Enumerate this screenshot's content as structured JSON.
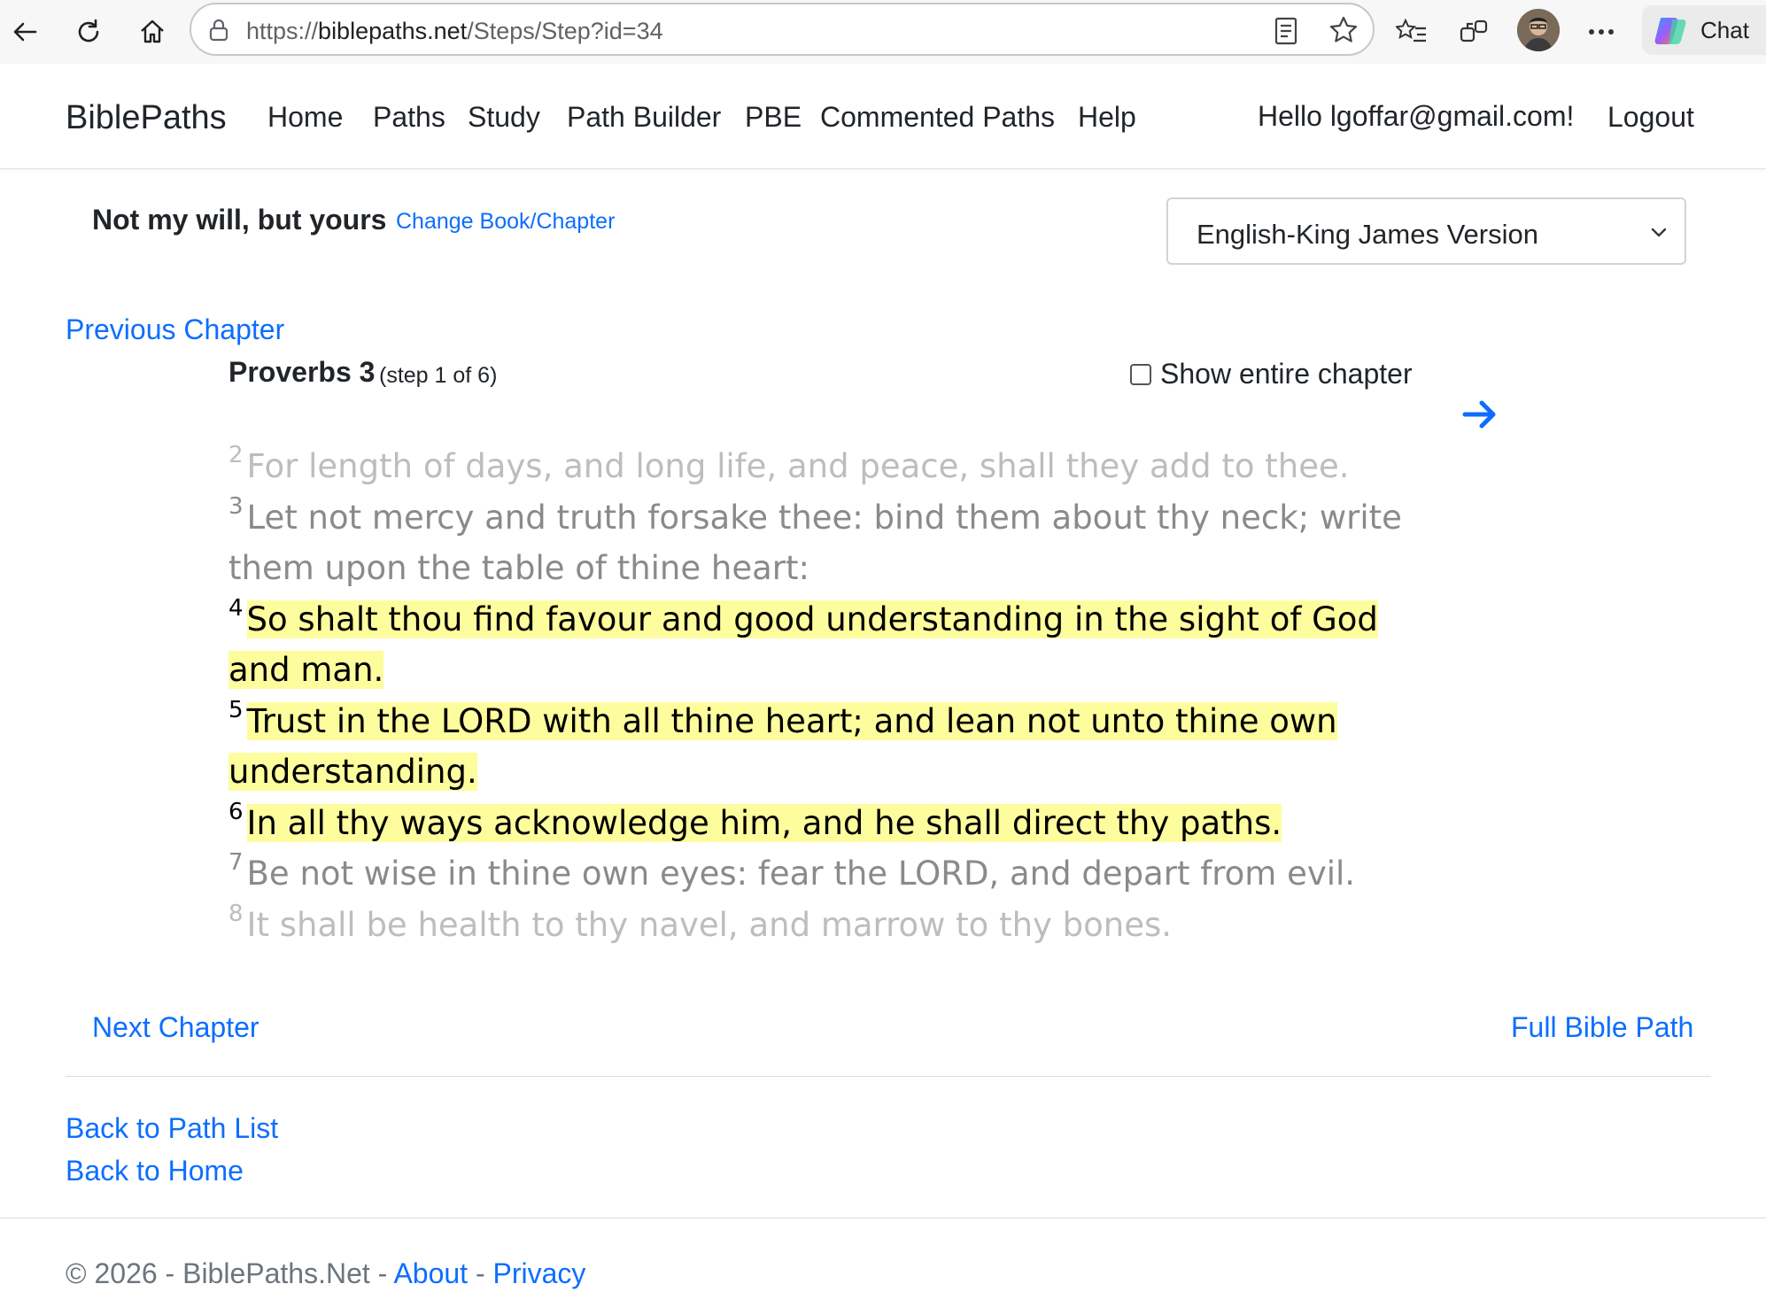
{
  "browser": {
    "url_prefix": "https://",
    "url_host": "biblepaths.net",
    "url_path": "/Steps/Step?id=34",
    "chat_label": "Chat",
    "icons": [
      "back-arrow-icon",
      "refresh-icon",
      "home-icon",
      "site-info-icon",
      "reader-view-icon",
      "favorite-star-icon",
      "favorites-list-icon",
      "extensions-icon",
      "more-icon",
      "copilot-icon"
    ]
  },
  "nav": {
    "brand": "BiblePaths",
    "items": [
      "Home",
      "Paths",
      "Study",
      "Path Builder",
      "PBE",
      "Commented Paths",
      "Help"
    ],
    "greeting": "Hello lgoffar@gmail.com!",
    "logout": "Logout"
  },
  "step": {
    "title": "Not my will, but yours",
    "change_link": "Change Book/Chapter",
    "version": "English-King James Version",
    "previous_chapter": "Previous Chapter",
    "chapter_heading": "Proverbs 3",
    "step_count": "(step 1 of 6)",
    "show_entire_label": "Show entire chapter",
    "show_entire_checked": false,
    "next_chapter": "Next Chapter",
    "full_path": "Full Bible Path"
  },
  "verses": [
    {
      "num": "2",
      "text": "For length of days, and long life, and peace, shall they add to thee.",
      "style": "faint"
    },
    {
      "num": "3",
      "text": "Let not mercy and truth forsake thee: bind them about thy neck; write them upon the table of thine heart:",
      "style": "dim"
    },
    {
      "num": "4",
      "text": "So shalt thou find favour and good understanding in the sight of God and man.",
      "style": "highlight"
    },
    {
      "num": "5",
      "text": "Trust in the LORD with all thine heart; and lean not unto thine own understanding.",
      "style": "highlight"
    },
    {
      "num": "6",
      "text": "In all thy ways acknowledge him, and he shall direct thy paths.",
      "style": "highlight"
    },
    {
      "num": "7",
      "text": "Be not wise in thine own eyes: fear the LORD, and depart from evil.",
      "style": "dim"
    },
    {
      "num": "8",
      "text": "It shall be health to thy navel, and marrow to thy bones.",
      "style": "faint"
    }
  ],
  "links": {
    "back_to_path_list": "Back to Path List",
    "back_to_home": "Back to Home"
  },
  "footer": {
    "copyright": "© 2026 - BiblePaths.Net - ",
    "about": "About",
    "separator": " - ",
    "privacy": "Privacy"
  },
  "colors": {
    "link": "#0d6efd",
    "highlight": "#fdfd9e",
    "faint_text": "#bdbdbd",
    "dim_text": "#8a8a8a"
  }
}
